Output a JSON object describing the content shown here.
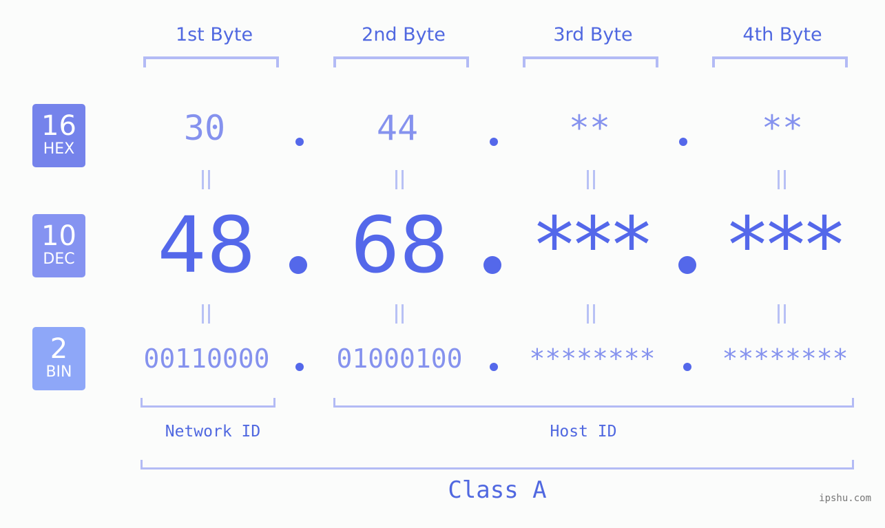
{
  "bases": [
    {
      "num": "16",
      "label": "HEX",
      "color": "#7583eb"
    },
    {
      "num": "10",
      "label": "DEC",
      "color": "#8593f1"
    },
    {
      "num": "2",
      "label": "BIN",
      "color": "#8ea7f8"
    }
  ],
  "bytes": [
    {
      "header": "1st Byte",
      "hex": "30",
      "dec": "48",
      "bin": "00110000"
    },
    {
      "header": "2nd Byte",
      "hex": "44",
      "dec": "68",
      "bin": "01000100"
    },
    {
      "header": "3rd Byte",
      "hex": "**",
      "dec": "***",
      "bin": "********"
    },
    {
      "header": "4th Byte",
      "hex": "**",
      "dec": "***",
      "bin": "********"
    }
  ],
  "parts": {
    "network": "Network ID",
    "host": "Host ID"
  },
  "class_label": "Class A",
  "watermark": "ipshu.com",
  "colors": {
    "accent": "#5468ea",
    "light": "#8592ee",
    "bracket": "#b3bbf5"
  }
}
